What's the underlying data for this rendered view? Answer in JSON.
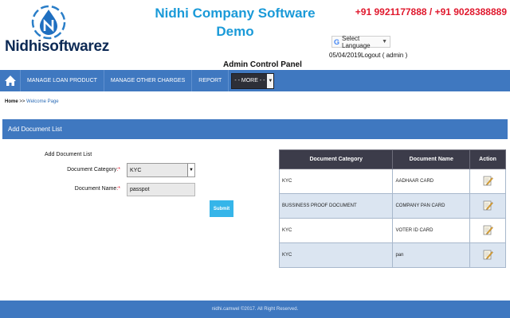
{
  "brand": {
    "name": "Nidhisoftwarez"
  },
  "header": {
    "title_line1": "Nidhi Company Software",
    "title_line2": "Demo",
    "phones": "+91 9921177888 / +91 9028388889",
    "language_label": "Select Language",
    "date": "05/04/2019",
    "logout": "Logout ( admin )",
    "panel_title": "Admin Control Panel"
  },
  "nav": {
    "items": [
      "MANAGE LOAN PRODUCT",
      "MANAGE OTHER CHARGES",
      "REPORT"
    ],
    "more_label": "- - MORE - -"
  },
  "breadcrumb": {
    "home": "Home",
    "separator": ">>",
    "current": "Welcome Page"
  },
  "panel": {
    "title": "Add Document List"
  },
  "form": {
    "title": "Add Document List",
    "category_label": "Document Category",
    "category_value": "KYC",
    "name_label": "Document Name",
    "name_value": "passpot",
    "required_mark": ":*",
    "submit_label": "Submit"
  },
  "table": {
    "headers": [
      "Document Category",
      "Document Name",
      "Action"
    ],
    "rows": [
      {
        "category": "KYC",
        "name": "AADHAAR CARD"
      },
      {
        "category": "BUSSINESS PROOF DOCUMENT",
        "name": "COMPANY PAN CARD"
      },
      {
        "category": "KYC",
        "name": "VOTER ID CARD"
      },
      {
        "category": "KYC",
        "name": "pan"
      }
    ],
    "action_icon": "edit-icon"
  },
  "footer": {
    "text": "nidhi.camwel ©2017. All Right Reserved."
  },
  "colors": {
    "nav_blue": "#3f78c0",
    "title_blue": "#1a9ad8",
    "phone_red": "#e0182d",
    "brand_navy": "#0d2a55",
    "table_header": "#3c3c4a",
    "row_alt": "#dbe5f1",
    "submit": "#36b5e9"
  }
}
